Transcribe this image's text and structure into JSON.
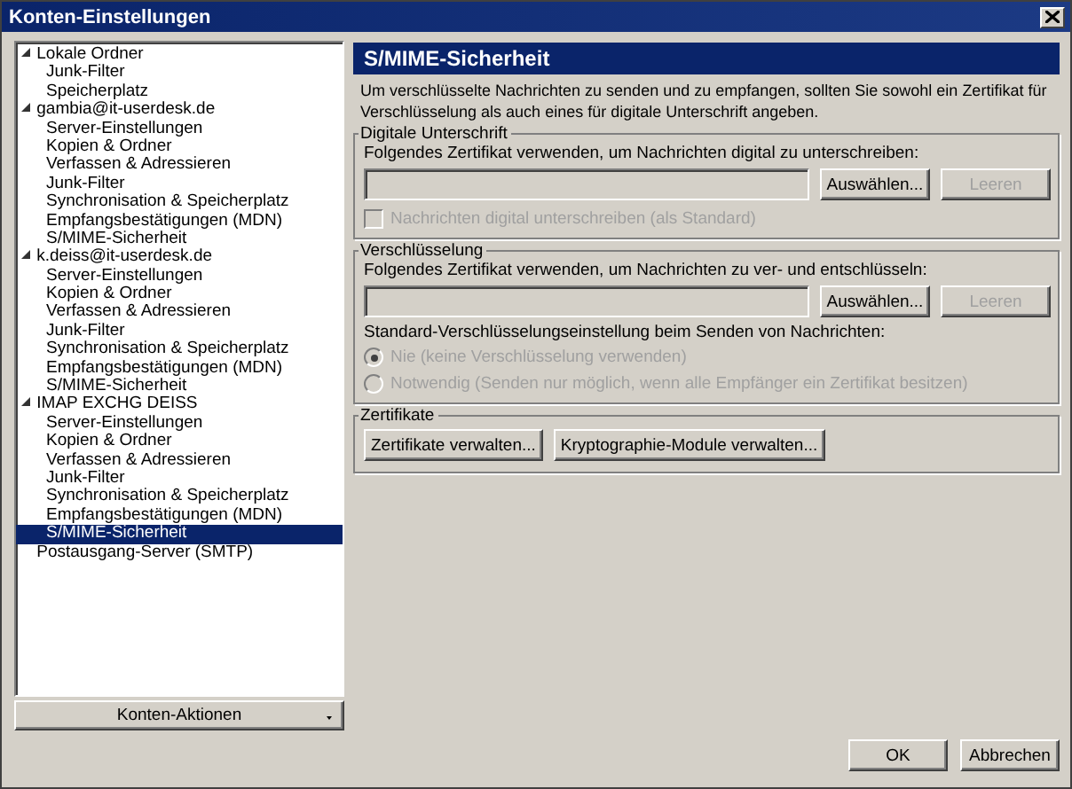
{
  "window": {
    "title": "Konten-Einstellungen"
  },
  "tree": [
    {
      "label": "Lokale Ordner",
      "expanded": true,
      "selected": false,
      "children": [
        {
          "label": "Junk-Filter",
          "selected": false
        },
        {
          "label": "Speicherplatz",
          "selected": false
        }
      ]
    },
    {
      "label": "gambia@it-userdesk.de",
      "expanded": true,
      "selected": false,
      "children": [
        {
          "label": "Server-Einstellungen",
          "selected": false
        },
        {
          "label": "Kopien & Ordner",
          "selected": false
        },
        {
          "label": "Verfassen & Adressieren",
          "selected": false
        },
        {
          "label": "Junk-Filter",
          "selected": false
        },
        {
          "label": "Synchronisation & Speicherplatz",
          "selected": false
        },
        {
          "label": "Empfangsbestätigungen (MDN)",
          "selected": false
        },
        {
          "label": "S/MIME-Sicherheit",
          "selected": false
        }
      ]
    },
    {
      "label": "k.deiss@it-userdesk.de",
      "expanded": true,
      "selected": false,
      "children": [
        {
          "label": "Server-Einstellungen",
          "selected": false
        },
        {
          "label": "Kopien & Ordner",
          "selected": false
        },
        {
          "label": "Verfassen & Adressieren",
          "selected": false
        },
        {
          "label": "Junk-Filter",
          "selected": false
        },
        {
          "label": "Synchronisation & Speicherplatz",
          "selected": false
        },
        {
          "label": "Empfangsbestätigungen (MDN)",
          "selected": false
        },
        {
          "label": "S/MIME-Sicherheit",
          "selected": false
        }
      ]
    },
    {
      "label": "IMAP EXCHG DEISS",
      "expanded": true,
      "selected": false,
      "children": [
        {
          "label": "Server-Einstellungen",
          "selected": false
        },
        {
          "label": "Kopien & Ordner",
          "selected": false
        },
        {
          "label": "Verfassen & Adressieren",
          "selected": false
        },
        {
          "label": "Junk-Filter",
          "selected": false
        },
        {
          "label": "Synchronisation & Speicherplatz",
          "selected": false
        },
        {
          "label": "Empfangsbestätigungen (MDN)",
          "selected": false
        },
        {
          "label": "S/MIME-Sicherheit",
          "selected": true
        }
      ]
    },
    {
      "label": "Postausgang-Server (SMTP)",
      "selected": false
    }
  ],
  "account_actions": {
    "label": "Konten-Aktionen"
  },
  "panel": {
    "title": "S/MIME-Sicherheit",
    "intro": "Um verschlüsselte Nachrichten zu senden und zu empfangen, sollten Sie sowohl ein Zertifikat für Verschlüsselung als auch eines für digitale Unterschrift angeben.",
    "signature": {
      "legend": "Digitale Unterschrift",
      "label": "Folgendes Zertifikat verwenden, um Nachrichten digital zu unterschreiben:",
      "buttons": [
        {
          "label": "Auswählen...",
          "disabled": false
        },
        {
          "label": "Leeren",
          "disabled": true
        }
      ],
      "checkbox": {
        "label": "Nachrichten digital unterschreiben (als Standard)",
        "checked": false,
        "disabled": true
      }
    },
    "encryption": {
      "legend": "Verschlüsselung",
      "label": "Folgendes Zertifikat verwenden, um Nachrichten zu ver- und entschlüsseln:",
      "buttons": [
        {
          "label": "Auswählen...",
          "disabled": false
        },
        {
          "label": "Leeren",
          "disabled": true
        }
      ],
      "radio_label": "Standard-Verschlüsselungseinstellung beim Senden von Nachrichten:",
      "radios": [
        {
          "label": "Nie (keine Verschlüsselung verwenden)",
          "selected": true,
          "disabled": true
        },
        {
          "label": "Notwendig (Senden nur möglich, wenn alle Empfänger ein Zertifikat besitzen)",
          "selected": false,
          "disabled": true
        }
      ]
    },
    "certificates": {
      "legend": "Zertifikate",
      "buttons": [
        {
          "label": "Zertifikate verwalten...",
          "disabled": false
        },
        {
          "label": "Kryptographie-Module verwalten...",
          "disabled": false
        }
      ]
    }
  },
  "footer": {
    "buttons": [
      {
        "label": "OK"
      },
      {
        "label": "Abbrechen"
      }
    ]
  }
}
